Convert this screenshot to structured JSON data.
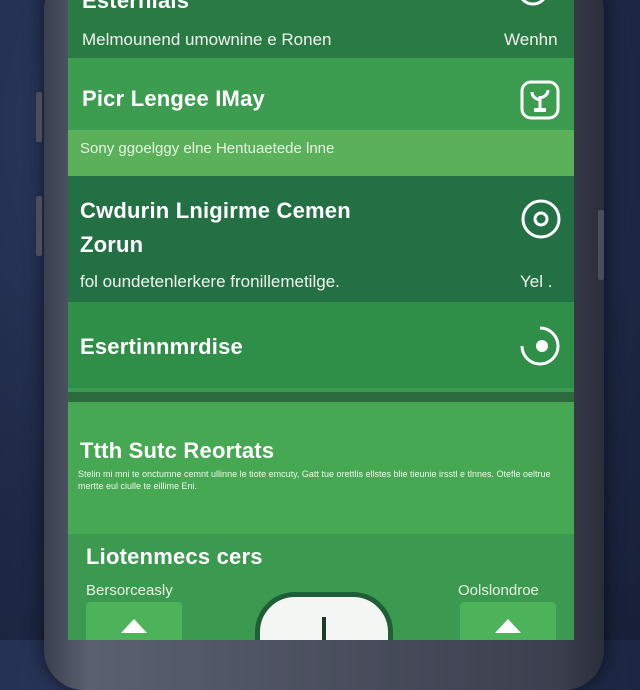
{
  "cards": [
    {
      "title": "Esternlals",
      "subtitle": "Melmounend umownine e Ronen",
      "right_text": "Wenhn",
      "icon": "chevron-down-icon"
    },
    {
      "title": "Picr Lengee IMay",
      "icon": "plant-icon",
      "band_text": "Sony ggoelggy elne Hentuaetede lnne"
    },
    {
      "title_line1": "Cwdurin Lnigirme Cemen",
      "title_line2": "Zorun",
      "subtitle": "fol oundetenlerkere fronillemetilge.",
      "right_text": "Yel .",
      "icon": "target-icon"
    },
    {
      "title": "Esertinnmrdise",
      "icon": "loading-ring-icon"
    },
    {
      "title": "Ttth Sutc Reortats",
      "body_text": "Stelin mi mni te onctumne cemnt ullinne le tiote emcuty, Gatt tue orettlis ellstes blie tieunie irsstl e tlnnes. Otefle oeltrue mertte eul ciulle te eillime Eni."
    },
    {
      "title": "Liotenmecs cers",
      "left_label": "Bersorceasly",
      "right_label": "Oolslondroe"
    }
  ],
  "colors": {
    "accent": "#3c9c50",
    "dark": "#237044",
    "light": "#5bb15a"
  }
}
